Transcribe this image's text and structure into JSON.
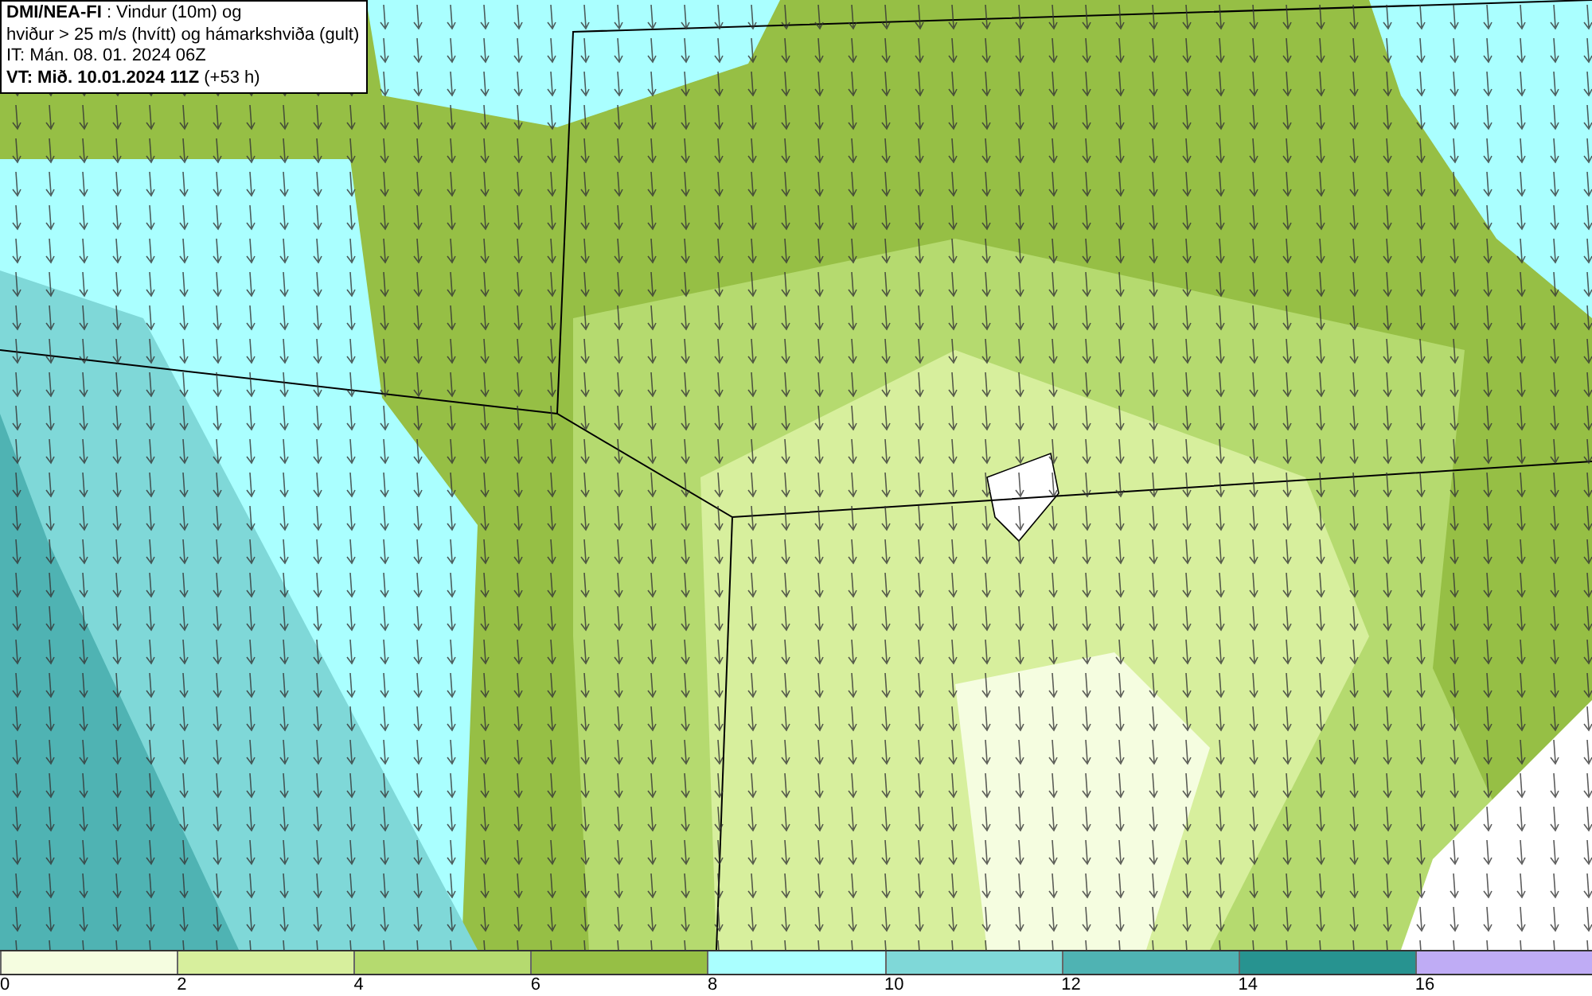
{
  "title_box": {
    "lines": [
      "**DMI/NEA-FI** : Vindur (10m) og",
      "hviður > 25 m/s (hvítt) og hámarkshviða (gult)",
      "IT: Mán. 08. 01. 2024 06Z",
      "**VT: Mið. 10.01.2024 11Z** (+53 h)"
    ]
  },
  "legend": {
    "bins": [
      {
        "color": "#f5fde0"
      },
      {
        "color": "#d7ef9d"
      },
      {
        "color": "#b5da6f"
      },
      {
        "color": "#96bf45"
      },
      {
        "color": "#aaffff"
      },
      {
        "color": "#7fd8d8"
      },
      {
        "color": "#4fb3b3"
      },
      {
        "color": "#279390"
      },
      {
        "color": "#bfacf5"
      }
    ],
    "ticks": [
      "0",
      "2",
      "4",
      "6",
      "8",
      "10",
      "12",
      "14",
      "16"
    ]
  }
}
